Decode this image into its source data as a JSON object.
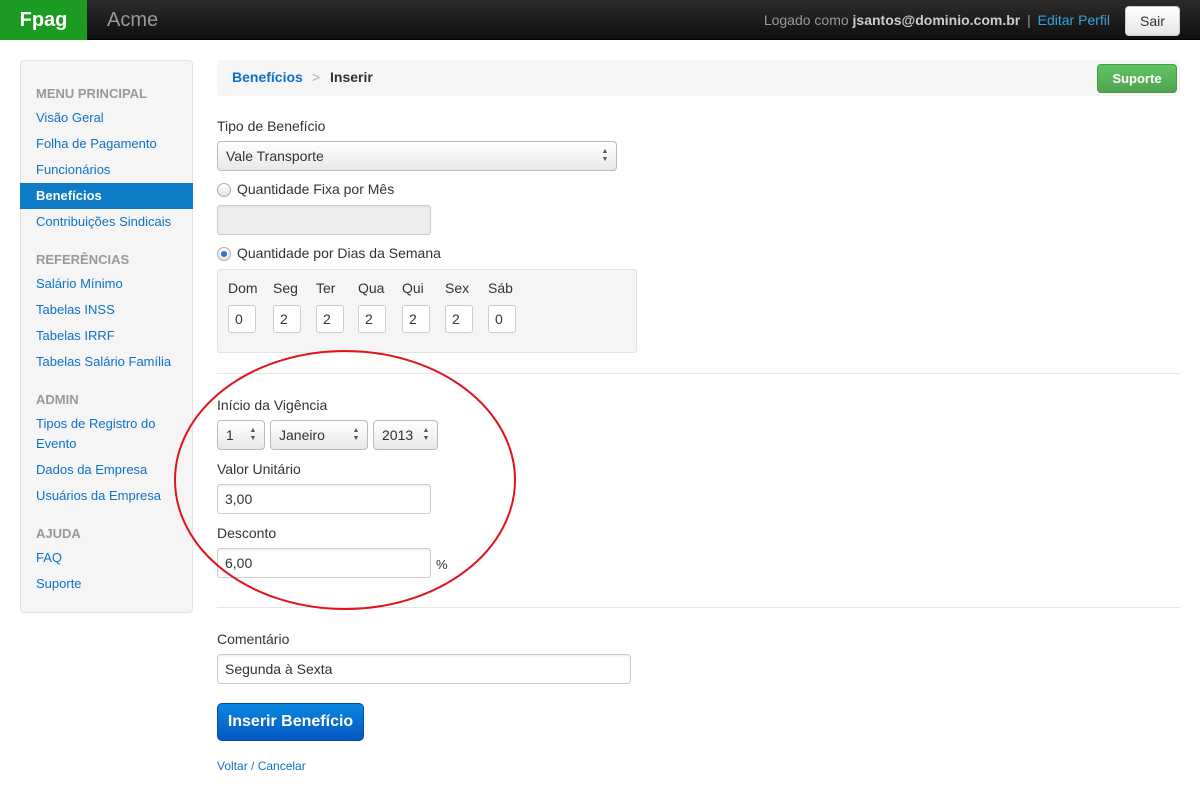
{
  "navbar": {
    "brand": "Fpag",
    "company": "Acme",
    "logged_as_prefix": "Logado como",
    "user_email": "jsantos@dominio.com.br",
    "separator": "|",
    "edit_profile": "Editar Perfil",
    "logout": "Sair"
  },
  "sidebar": {
    "sections": [
      {
        "header": "MENU PRINCIPAL",
        "items": [
          "Visão Geral",
          "Folha de Pagamento",
          "Funcionários",
          "Benefícios",
          "Contribuições Sindicais"
        ]
      },
      {
        "header": "REFERÊNCIAS",
        "items": [
          "Salário Mínimo",
          "Tabelas INSS",
          "Tabelas IRRF",
          "Tabelas Salário Família"
        ]
      },
      {
        "header": "ADMIN",
        "items": [
          "Tipos de Registro do Evento",
          "Dados da Empresa",
          "Usuários da Empresa"
        ]
      },
      {
        "header": "AJUDA",
        "items": [
          "FAQ",
          "Suporte"
        ]
      }
    ],
    "active_item": "Benefícios"
  },
  "breadcrumb": {
    "parent": "Benefícios",
    "separator": ">",
    "current": "Inserir",
    "support_button": "Suporte"
  },
  "form": {
    "benefit_type_label": "Tipo de Benefício",
    "benefit_type_value": "Vale Transporte",
    "fixed_quantity_label": "Quantidade Fixa por Mês",
    "fixed_quantity_value": "",
    "fixed_quantity_checked": false,
    "weekday_quantity_label": "Quantidade por Dias da Semana",
    "weekday_quantity_checked": true,
    "days": [
      {
        "label": "Dom",
        "value": "0"
      },
      {
        "label": "Seg",
        "value": "2"
      },
      {
        "label": "Ter",
        "value": "2"
      },
      {
        "label": "Qua",
        "value": "2"
      },
      {
        "label": "Qui",
        "value": "2"
      },
      {
        "label": "Sex",
        "value": "2"
      },
      {
        "label": "Sáb",
        "value": "0"
      }
    ],
    "start_label": "Início da Vigência",
    "start_day": "1",
    "start_month": "Janeiro",
    "start_year": "2013",
    "unit_value_label": "Valor Unitário",
    "unit_value": "3,00",
    "discount_label": "Desconto",
    "discount_value": "6,00",
    "discount_unit": "%",
    "comment_label": "Comentário",
    "comment_value": "Segunda à Sexta",
    "submit": "Inserir Benefício",
    "back_link": "Voltar / Cancelar"
  },
  "colors": {
    "brand_green": "#1c9b22",
    "link_blue": "#0e71c7",
    "active_blue": "#0e7cc7",
    "support_green": "#51a351",
    "primary_blue": "#0456c2",
    "annotation_red": "#e0141b"
  }
}
